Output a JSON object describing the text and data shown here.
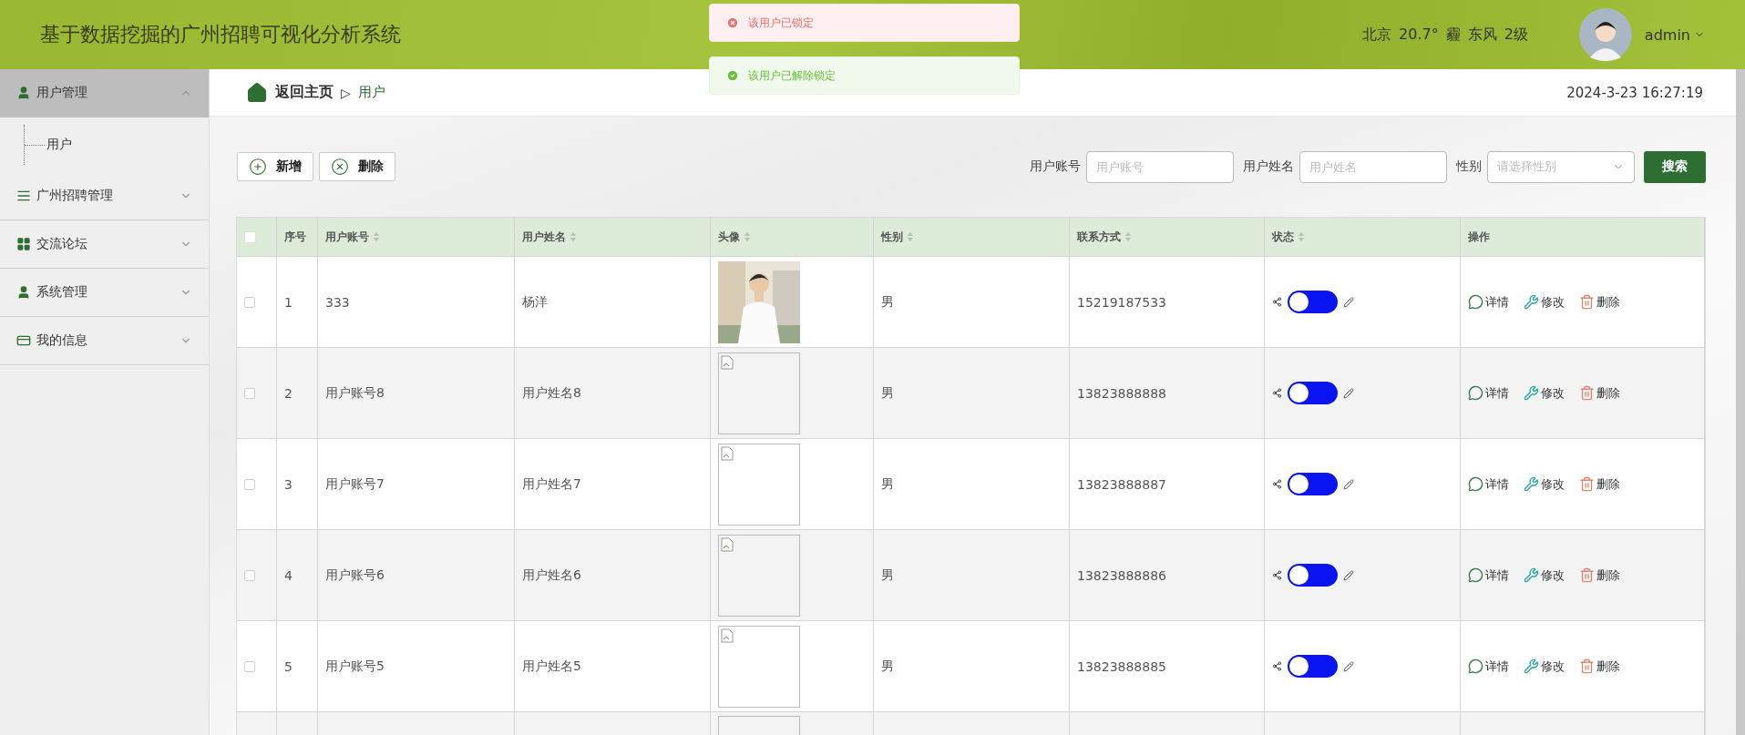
{
  "header": {
    "title": "基于数据挖掘的广州招聘可视化分析系统",
    "weather": [
      "北京",
      "20.7°",
      "霾",
      "东风",
      "2级"
    ],
    "user": "admin"
  },
  "toasts": [
    {
      "kind": "error",
      "text": "该用户已锁定"
    },
    {
      "kind": "success",
      "text": "该用户已解除锁定"
    }
  ],
  "sidebar": {
    "items": [
      {
        "label": "用户管理",
        "expanded": true,
        "selected": true,
        "children": [
          {
            "label": "用户"
          }
        ]
      },
      {
        "label": "广州招聘管理",
        "expanded": false,
        "selected": false
      },
      {
        "label": "交流论坛",
        "expanded": false,
        "selected": false
      },
      {
        "label": "系统管理",
        "expanded": false,
        "selected": false
      },
      {
        "label": "我的信息",
        "expanded": false,
        "selected": false
      }
    ]
  },
  "breadcrumb": {
    "home": "返回主页",
    "separator": "▷",
    "current": "用户"
  },
  "datetime": "2024-3-23 16:27:19",
  "toolbar": {
    "buttons": [
      {
        "kind": "add",
        "label": "新增"
      },
      {
        "kind": "delete",
        "label": "删除"
      }
    ],
    "filters": [
      {
        "label": "用户账号",
        "kind": "input",
        "placeholder": "用户账号"
      },
      {
        "label": "用户姓名",
        "kind": "input",
        "placeholder": "用户姓名"
      },
      {
        "label": "性别",
        "kind": "select",
        "placeholder": "请选择性别"
      }
    ],
    "search": "搜索"
  },
  "table": {
    "all_checked": false,
    "columns": [
      {
        "label": "序号",
        "sortable": false
      },
      {
        "label": "用户账号",
        "sortable": true
      },
      {
        "label": "用户姓名",
        "sortable": true
      },
      {
        "label": "头像",
        "sortable": true
      },
      {
        "label": "性别",
        "sortable": true
      },
      {
        "label": "联系方式",
        "sortable": true
      },
      {
        "label": "状态",
        "sortable": true
      },
      {
        "label": "操作",
        "sortable": false
      }
    ],
    "rows": [
      {
        "checked": false,
        "index": "1",
        "account": "333",
        "name": "杨洋",
        "gender": "男",
        "phone": "15219187533",
        "on": false,
        "actions": [
          {
            "kind": "detail",
            "label": "详情"
          },
          {
            "kind": "edit",
            "label": "修改"
          },
          {
            "kind": "delete",
            "label": "删除"
          }
        ]
      },
      {
        "checked": false,
        "index": "2",
        "account": "用户账号8",
        "name": "用户姓名8",
        "avatar": {
          "kind": "broken"
        },
        "gender": "男",
        "phone": "13823888888",
        "on": false,
        "actions": [
          {
            "kind": "detail",
            "label": "详情"
          },
          {
            "kind": "edit",
            "label": "修改"
          },
          {
            "kind": "delete",
            "label": "删除"
          }
        ]
      },
      {
        "checked": false,
        "index": "3",
        "account": "用户账号7",
        "name": "用户姓名7",
        "avatar": {
          "kind": "broken"
        },
        "gender": "男",
        "phone": "13823888887",
        "on": false,
        "actions": [
          {
            "kind": "detail",
            "label": "详情"
          },
          {
            "kind": "edit",
            "label": "修改"
          },
          {
            "kind": "delete",
            "label": "删除"
          }
        ]
      },
      {
        "checked": false,
        "index": "4",
        "account": "用户账号6",
        "name": "用户姓名6",
        "avatar": {
          "kind": "broken"
        },
        "gender": "男",
        "phone": "13823888886",
        "on": false,
        "actions": [
          {
            "kind": "detail",
            "label": "详情"
          },
          {
            "kind": "edit",
            "label": "修改"
          },
          {
            "kind": "delete",
            "label": "删除"
          }
        ]
      },
      {
        "checked": false,
        "index": "5",
        "account": "用户账号5",
        "name": "用户姓名5",
        "avatar": {
          "kind": "broken"
        },
        "gender": "男",
        "phone": "13823888885",
        "on": false,
        "actions": [
          {
            "kind": "detail",
            "label": "详情"
          },
          {
            "kind": "edit",
            "label": "修改"
          },
          {
            "kind": "delete",
            "label": "删除"
          }
        ]
      }
    ]
  }
}
